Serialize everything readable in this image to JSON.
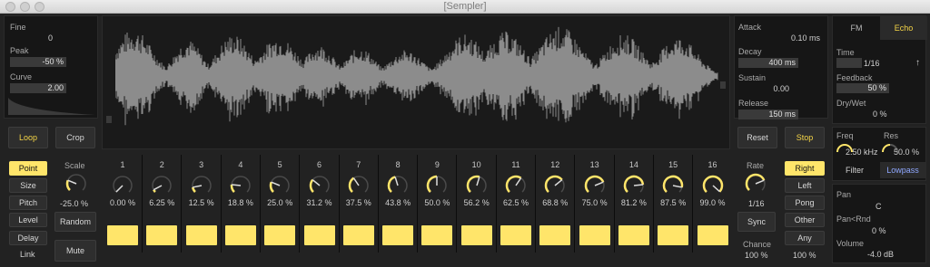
{
  "window": {
    "title": "[Sempler]"
  },
  "colors": {
    "accent": "#ffe56a",
    "accent_text": "#f5d547",
    "panel": "#161616",
    "waveform": "#8c8c8c",
    "link_blue": "#8fa8ff"
  },
  "left_panel": {
    "fine_label": "Fine",
    "fine_value": "0",
    "peak_label": "Peak",
    "peak_value": "-50 %",
    "curve_label": "Curve",
    "curve_value": "2.00"
  },
  "buttons": {
    "loop": "Loop",
    "crop": "Crop",
    "reset": "Reset",
    "stop": "Stop",
    "random": "Random",
    "mute": "Mute",
    "sync": "Sync"
  },
  "envelope": {
    "attack_label": "Attack",
    "attack_value": "0.10 ms",
    "decay_label": "Decay",
    "decay_value": "400 ms",
    "sustain_label": "Sustain",
    "sustain_value": "0.00",
    "release_label": "Release",
    "release_value": "150 ms"
  },
  "fx": {
    "tab_fm": "FM",
    "tab_echo": "Echo",
    "time_label": "Time",
    "time_value": "1/16",
    "feedback_label": "Feedback",
    "feedback_value": "50 %",
    "drywet_label": "Dry/Wet",
    "drywet_value": "0 %"
  },
  "filter": {
    "freq_label": "Freq",
    "freq_value": "2.50 kHz",
    "res_label": "Res",
    "res_value": "50.0 %",
    "filter_btn": "Filter",
    "type": "Lowpass"
  },
  "output": {
    "pan_label": "Pan",
    "pan_value": "C",
    "panrnd_label": "Pan<Rnd",
    "panrnd_value": "0 %",
    "volume_label": "Volume",
    "volume_value": "-4.0 dB"
  },
  "modes": [
    "Point",
    "Size",
    "Pitch",
    "Level",
    "Delay"
  ],
  "mode_link": "Link",
  "scale": {
    "label": "Scale",
    "value": "-25.0 %",
    "level": -0.25
  },
  "steps": [
    {
      "num": "1",
      "value": "0.00 %",
      "level": 0.0
    },
    {
      "num": "2",
      "value": "6.25 %",
      "level": 0.0625
    },
    {
      "num": "3",
      "value": "12.5 %",
      "level": 0.125
    },
    {
      "num": "4",
      "value": "18.8 %",
      "level": 0.188
    },
    {
      "num": "5",
      "value": "25.0 %",
      "level": 0.25
    },
    {
      "num": "6",
      "value": "31.2 %",
      "level": 0.312
    },
    {
      "num": "7",
      "value": "37.5 %",
      "level": 0.375
    },
    {
      "num": "8",
      "value": "43.8 %",
      "level": 0.438
    },
    {
      "num": "9",
      "value": "50.0 %",
      "level": 0.5
    },
    {
      "num": "10",
      "value": "56.2 %",
      "level": 0.562
    },
    {
      "num": "11",
      "value": "62.5 %",
      "level": 0.625
    },
    {
      "num": "12",
      "value": "68.8 %",
      "level": 0.688
    },
    {
      "num": "13",
      "value": "75.0 %",
      "level": 0.75
    },
    {
      "num": "14",
      "value": "81.2 %",
      "level": 0.812
    },
    {
      "num": "15",
      "value": "87.5 %",
      "level": 0.875
    },
    {
      "num": "16",
      "value": "99.0 %",
      "level": 0.99
    }
  ],
  "rate": {
    "label": "Rate",
    "value": "1/16",
    "level": 0.75
  },
  "chance": {
    "label": "Chance",
    "value": "100 %"
  },
  "directions": {
    "right": "Right",
    "left": "Left",
    "pong": "Pong",
    "other": "Other",
    "any": "Any",
    "amount": "100 %"
  }
}
